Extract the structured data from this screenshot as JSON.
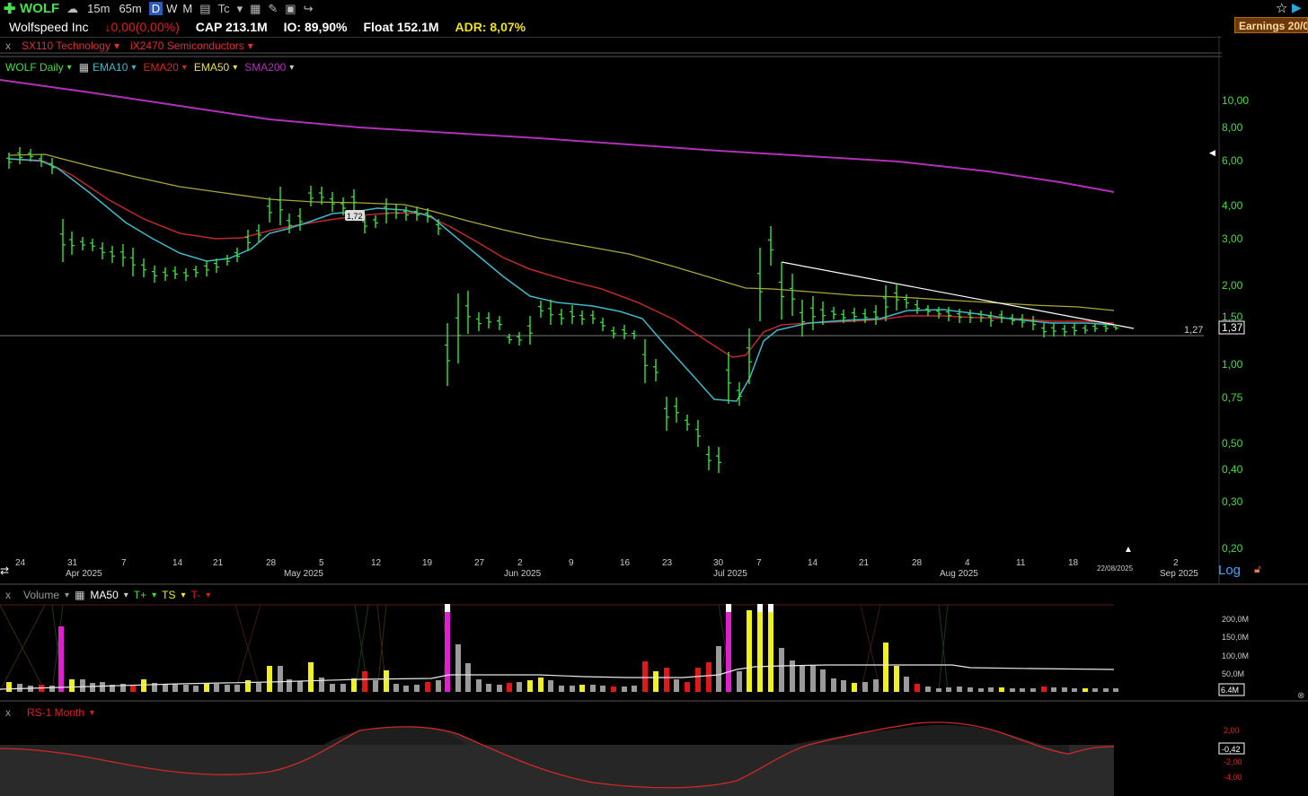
{
  "toolbar": {
    "symbol": "WOLF",
    "timeframes": [
      "15m",
      "65m",
      "D",
      "W",
      "M"
    ],
    "active_timeframe": "D"
  },
  "info": {
    "company": "Wolfspeed Inc",
    "change": "↓0,00(0,00%)",
    "cap": "CAP 213.1M",
    "io": "IO: 89,90%",
    "float": "Float 152.1M",
    "adr": "ADR: 8,07%",
    "earnings": "Earnings 20/0"
  },
  "sectors": {
    "sector": "SX110 Technology",
    "industry": "iX2470 Semiconductors"
  },
  "indicators": {
    "main": "WOLF Daily",
    "ema10": "EMA10",
    "ema20": "EMA20",
    "ema50": "EMA50",
    "sma200": "SMA200"
  },
  "price_axis": {
    "labels": [
      "10,00",
      "8,00",
      "6,00",
      "4,00",
      "3,00",
      "2,00",
      "1,50",
      "1,00",
      "0,75",
      "0,50",
      "0,40",
      "0,30",
      "0,20"
    ],
    "last_price": "1,37",
    "hline_label": "1,27",
    "scale": "Log",
    "flag_label": "22/08/2025"
  },
  "date_axis": {
    "days": [
      "24",
      "31",
      "7",
      "14",
      "21",
      "28",
      "5",
      "12",
      "19",
      "27",
      "2",
      "9",
      "16",
      "23",
      "30",
      "7",
      "14",
      "21",
      "28",
      "4",
      "11",
      "18",
      "2"
    ],
    "months": [
      "Apr 2025",
      "May 2025",
      "Jun 2025",
      "Jul 2025",
      "Aug 2025",
      "Sep 2025"
    ]
  },
  "volume_panel": {
    "title": "Volume",
    "ma": "MA50",
    "t_plus": "T+",
    "ts": "TS",
    "t_minus": "T-",
    "axis": [
      "200,0M",
      "150,0M",
      "100,0M",
      "50,0M"
    ],
    "last": "6.4M"
  },
  "rs_panel": {
    "title": "RS-1 Month",
    "axis": [
      "2,00",
      "-2,00",
      "-4,00"
    ],
    "last": "-0,42"
  },
  "annotations": {
    "price_tag": "1,72"
  },
  "colors": {
    "up": "#3ee03e",
    "ema10": "#3fb8c8",
    "ema20": "#c0282a",
    "ema50": "#a8a838",
    "sma200": "#b030b8",
    "vol_pink": "#e020d0",
    "vol_yellow": "#f0f020",
    "vol_red": "#e01818",
    "vol_gray": "#9a9a9a"
  }
}
